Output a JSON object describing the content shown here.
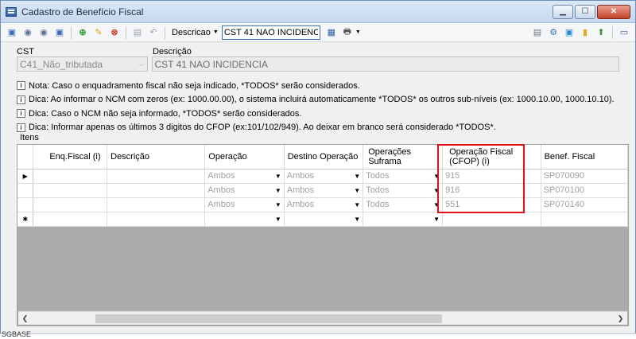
{
  "window": {
    "title": "Cadastro de Benefício Fiscal"
  },
  "toolbar": {
    "field_selector": "Descricao",
    "search_value": "CST 41 NAO INCIDENCIA",
    "icons": [
      "first-icon",
      "prev-icon",
      "next-icon",
      "last-icon",
      "add-icon",
      "edit-icon",
      "delete-icon",
      "save-icon",
      "undo-icon",
      "search-grid-icon",
      "print-icon",
      "filter-icon",
      "tools-icon",
      "export-icon",
      "doc-icon",
      "info-icon",
      "exit-icon"
    ]
  },
  "form": {
    "cst_label": "CST",
    "cst_value": "C41_Não_tributada",
    "descricao_label": "Descrição",
    "descricao_value": "CST 41 NAO INCIDENCIA"
  },
  "notes": [
    "Nota: Caso o enquadramento fiscal não seja indicado, *TODOS* serão considerados.",
    "Dica: Ao informar o NCM com zeros (ex: 1000.00.00), o sistema incluirá automaticamente *TODOS* os outros sub-níveis (ex: 1000.10.00, 1000.10.10).",
    "Dica: Caso o NCM não seja informado, *TODOS* serão considerados.",
    "Dica: Informar apenas os últimos 3 digitos do CFOP (ex:101/102/949). Ao deixar em branco será considerado *TODOS*."
  ],
  "grid": {
    "group_label": "Itens",
    "columns": {
      "enq": "Enq.Fiscal (i)",
      "descricao": "Descrição",
      "operacao": "Operação",
      "destino": "Destino Operação",
      "suframa": "Operações Suframa",
      "cfop": "Operação Fiscal (CFOP) (i)",
      "benef": "Benef. Fiscal"
    },
    "rows": [
      {
        "enq": "",
        "descricao": "",
        "operacao": "Ambos",
        "destino": "Ambos",
        "suframa": "Todos",
        "cfop": "915",
        "benef": "SP070090"
      },
      {
        "enq": "",
        "descricao": "",
        "operacao": "Ambos",
        "destino": "Ambos",
        "suframa": "Todos",
        "cfop": "916",
        "benef": "SP070100"
      },
      {
        "enq": "",
        "descricao": "",
        "operacao": "Ambos",
        "destino": "Ambos",
        "suframa": "Todos",
        "cfop": "551",
        "benef": "SP070140"
      }
    ]
  },
  "footer": {
    "text": "SGBASE"
  }
}
